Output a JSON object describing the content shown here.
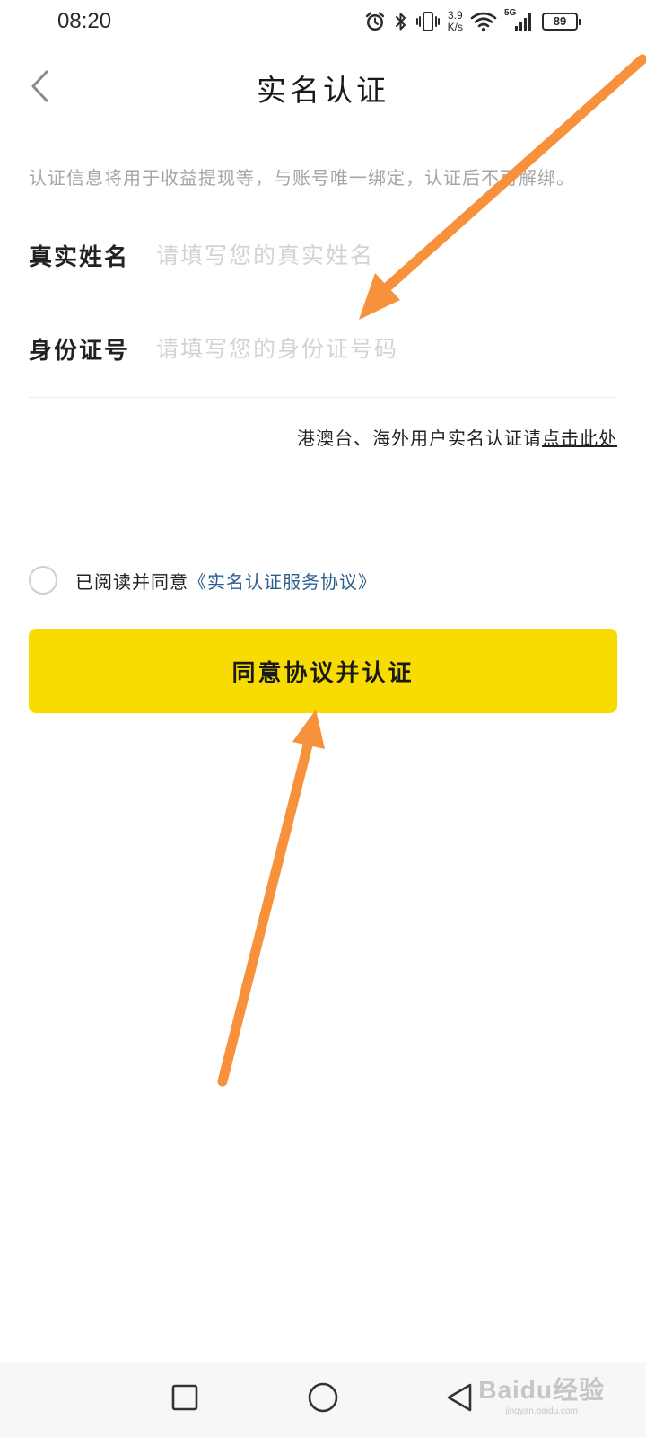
{
  "status_bar": {
    "time": "08:20",
    "net_speed_value": "3.9",
    "net_speed_unit": "K/s",
    "signal_label": "5G",
    "battery_level": "89",
    "icons": [
      "alarm-icon",
      "bluetooth-icon",
      "vibrate-icon",
      "wifi-icon",
      "cellular-signal-icon",
      "battery-icon"
    ]
  },
  "header": {
    "title": "实名认证",
    "back_icon": "chevron-left-icon"
  },
  "notice": "认证信息将用于收益提现等，与账号唯一绑定，认证后不可解绑。",
  "form": {
    "name": {
      "label": "真实姓名",
      "placeholder": "请填写您的真实姓名",
      "value": ""
    },
    "id_number": {
      "label": "身份证号",
      "placeholder": "请填写您的身份证号码",
      "value": ""
    }
  },
  "overseas": {
    "text": "港澳台、海外用户实名认证请",
    "link": "点击此处"
  },
  "agreement": {
    "text": "已阅读并同意",
    "link": "《实名认证服务协议》",
    "checked": false
  },
  "submit_label": "同意协议并认证",
  "colors": {
    "accent_yellow": "#f8dc00",
    "link_blue": "#2d5c8f",
    "annotation_orange": "#f7913b",
    "placeholder_gray": "#d3d3d3",
    "notice_gray": "#a6a6a6"
  },
  "system_nav": {
    "recent_icon": "square-icon",
    "home_icon": "circle-icon",
    "back_icon": "triangle-back-icon"
  },
  "watermark": {
    "logo": "Baidu经验",
    "url": "jingyan.baidu.com"
  }
}
